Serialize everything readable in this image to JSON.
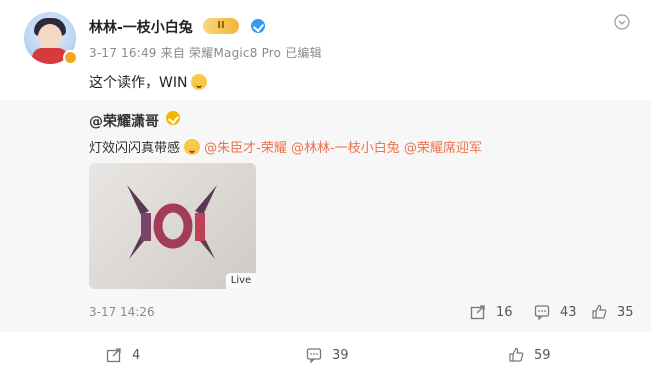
{
  "post": {
    "author": "林林-一枝小白兔",
    "level_badge": "II",
    "meta": "3-17 16:49  来自 荣耀Magic8 Pro 已编辑",
    "content_text": "这个读作，WIN"
  },
  "repost": {
    "author": "@荣耀潇哥",
    "text_plain": "灯效闪闪真带感",
    "mentions": [
      "@朱臣才-荣耀",
      "@林林-一枝小白兔",
      "@荣耀席迎军"
    ],
    "media_badge": "Live",
    "time": "3-17 14:26",
    "share_count": "16",
    "comment_count": "43",
    "like_count": "35"
  },
  "footer": {
    "share_count": "4",
    "comment_count": "39",
    "like_count": "59"
  },
  "colors": {
    "mention": "#eb7350",
    "verify_blue": "#2e9cf5",
    "verify_gold": "#f5b800",
    "repost_bg": "#f7f7f7"
  },
  "icons": [
    "more-icon",
    "share-icon",
    "comment-icon",
    "like-icon",
    "verify-icon",
    "emoji-icon"
  ]
}
